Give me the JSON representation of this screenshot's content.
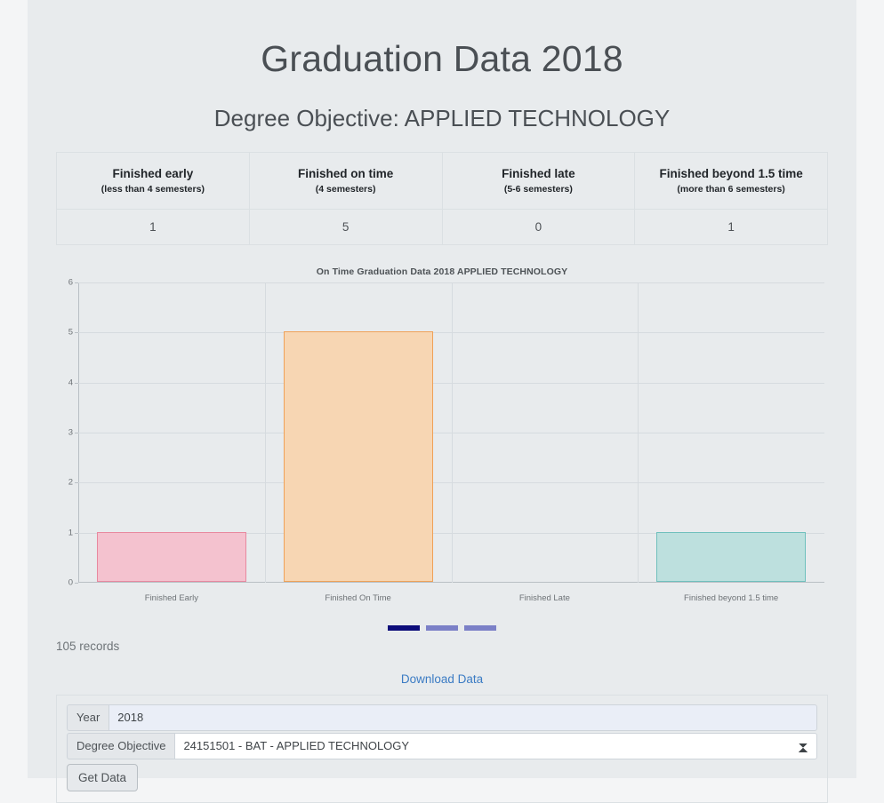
{
  "page": {
    "title": "Graduation Data 2018",
    "subtitle": "Degree Objective: APPLIED TECHNOLOGY",
    "records_text": "105 records",
    "download_label": "Download Data"
  },
  "summary_table": {
    "headers": [
      {
        "title": "Finished early",
        "sub": "(less than 4 semesters)"
      },
      {
        "title": "Finished on time",
        "sub": "(4 semesters)"
      },
      {
        "title": "Finished late",
        "sub": "(5-6 semesters)"
      },
      {
        "title": "Finished beyond 1.5 time",
        "sub": "(more than 6 semesters)"
      }
    ],
    "values": [
      "1",
      "5",
      "0",
      "1"
    ]
  },
  "chart_data": {
    "type": "bar",
    "title": "On Time Graduation Data 2018 APPLIED TECHNOLOGY",
    "categories": [
      "Finished Early",
      "Finished On Time",
      "Finished Late",
      "Finished beyond 1.5 time"
    ],
    "values": [
      1,
      5,
      0,
      1
    ],
    "colors": [
      "#f4c2cf",
      "#f7d6b3",
      "#e8ebed",
      "#bde0de"
    ],
    "border_colors": [
      "#e8889f",
      "#efa158",
      "#d6dbdf",
      "#6fc0bd"
    ],
    "xlabel": "",
    "ylabel": "",
    "ylim": [
      0,
      6
    ],
    "yticks": [
      0,
      1,
      2,
      3,
      4,
      5,
      6
    ],
    "ytick_labels": [
      "0",
      "1",
      "2",
      "3",
      "4",
      "5",
      "6"
    ],
    "grid": true,
    "legend": "none"
  },
  "carousel": {
    "indicators": [
      {
        "state": "active",
        "color": "#0d0d7a"
      },
      {
        "state": "inactive",
        "color": "#7b80c7"
      },
      {
        "state": "inactive",
        "color": "#7b80c7"
      }
    ]
  },
  "form": {
    "year": {
      "label": "Year",
      "value": "2018",
      "placeholder": "Year"
    },
    "degree_objective": {
      "label": "Degree Objective",
      "selected": "24151501 - BAT - APPLIED TECHNOLOGY",
      "options": [
        "24151501 - BAT - APPLIED TECHNOLOGY"
      ]
    },
    "submit_label": "Get Data"
  }
}
